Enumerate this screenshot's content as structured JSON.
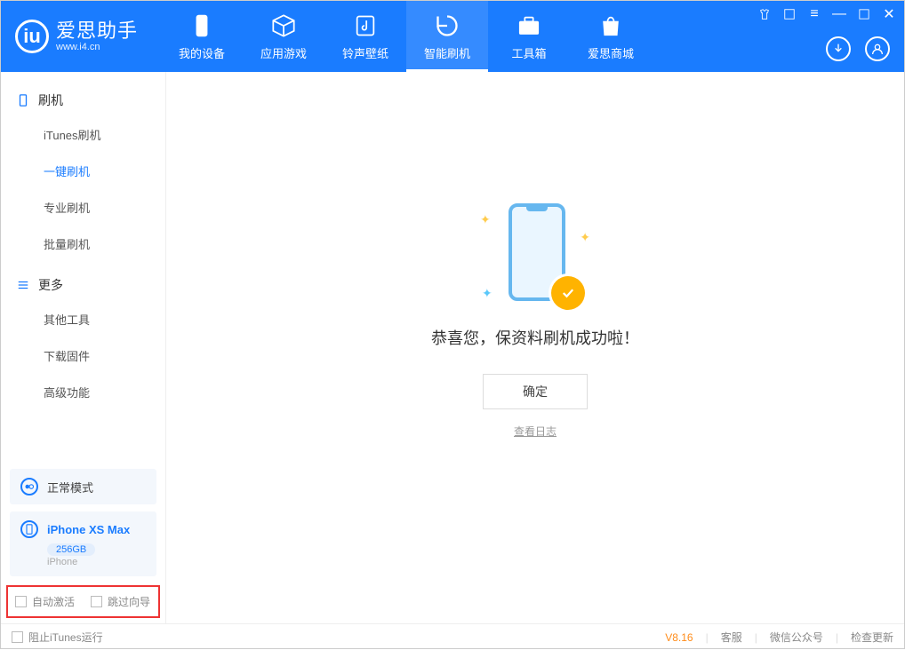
{
  "app": {
    "title": "爱思助手",
    "subtitle": "www.i4.cn"
  },
  "nav": {
    "items": [
      {
        "label": "我的设备"
      },
      {
        "label": "应用游戏"
      },
      {
        "label": "铃声壁纸"
      },
      {
        "label": "智能刷机"
      },
      {
        "label": "工具箱"
      },
      {
        "label": "爱思商城"
      }
    ]
  },
  "sidebar": {
    "group1_title": "刷机",
    "group1_items": [
      {
        "label": "iTunes刷机"
      },
      {
        "label": "一键刷机"
      },
      {
        "label": "专业刷机"
      },
      {
        "label": "批量刷机"
      }
    ],
    "group2_title": "更多",
    "group2_items": [
      {
        "label": "其他工具"
      },
      {
        "label": "下载固件"
      },
      {
        "label": "高级功能"
      }
    ],
    "mode_card": "正常模式",
    "device": {
      "name": "iPhone XS Max",
      "storage": "256GB",
      "type": "iPhone"
    },
    "auto_activate": "自动激活",
    "skip_guide": "跳过向导"
  },
  "main": {
    "success_text": "恭喜您，保资料刷机成功啦！",
    "ok_button": "确定",
    "view_log": "查看日志"
  },
  "footer": {
    "block_itunes": "阻止iTunes运行",
    "version": "V8.16",
    "links": [
      "客服",
      "微信公众号",
      "检查更新"
    ]
  }
}
